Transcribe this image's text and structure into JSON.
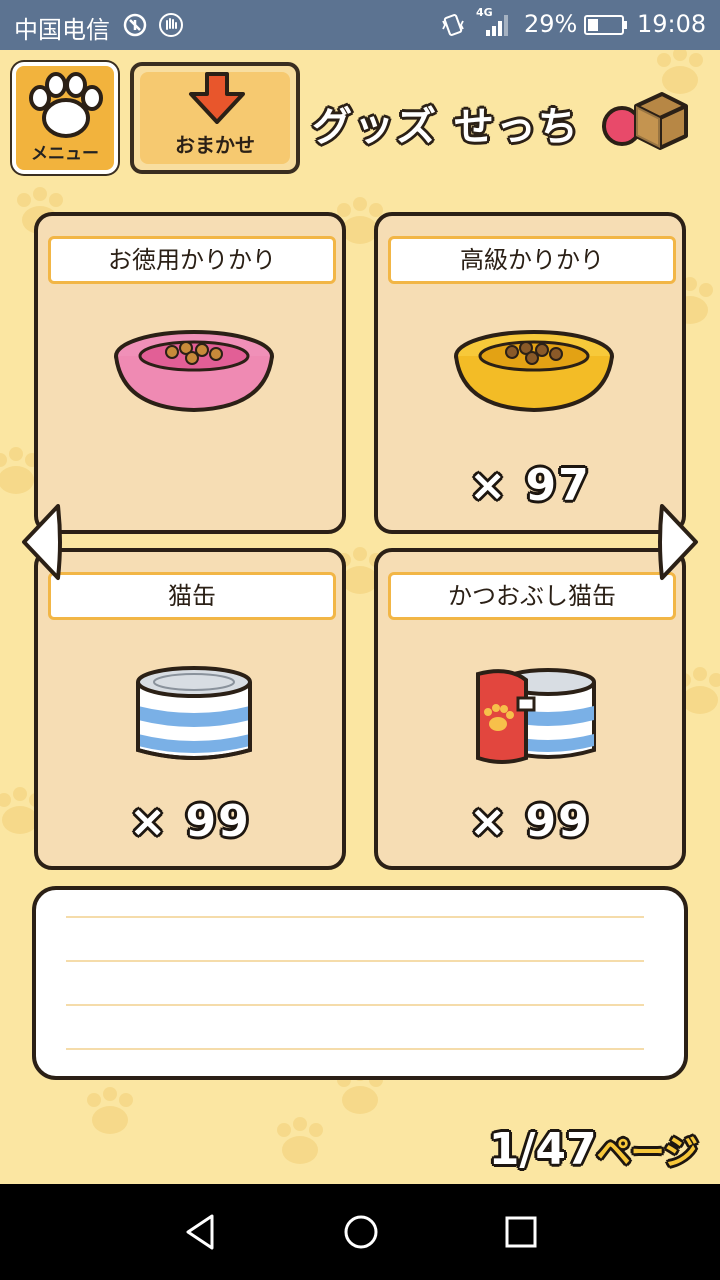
{
  "status_bar": {
    "carrier": "中国电信",
    "network": "4G",
    "battery_percent": "29%",
    "time": "19:08",
    "icons": [
      "usb-debug-icon",
      "hand-icon",
      "vibrate-icon",
      "signal-icon",
      "battery-icon"
    ]
  },
  "header": {
    "menu_label": "メニュー",
    "auto_label": "おまかせ",
    "title": "グッズ せっち",
    "accent_color": "#f2b33d"
  },
  "items": [
    {
      "name": "お徳用かりかり",
      "quantity": "",
      "icon": "pink-food-bowl-icon"
    },
    {
      "name": "高級かりかり",
      "quantity": "× 97",
      "icon": "gold-food-bowl-icon"
    },
    {
      "name": "猫缶",
      "quantity": "× 99",
      "icon": "cat-can-icon"
    },
    {
      "name": "かつおぶし猫缶",
      "quantity": "× 99",
      "icon": "bonito-cat-can-icon"
    }
  ],
  "pagination": {
    "current": "1/47",
    "unit": "ページ"
  },
  "nav": {
    "icons": [
      "back-icon",
      "home-icon",
      "recents-icon"
    ]
  }
}
